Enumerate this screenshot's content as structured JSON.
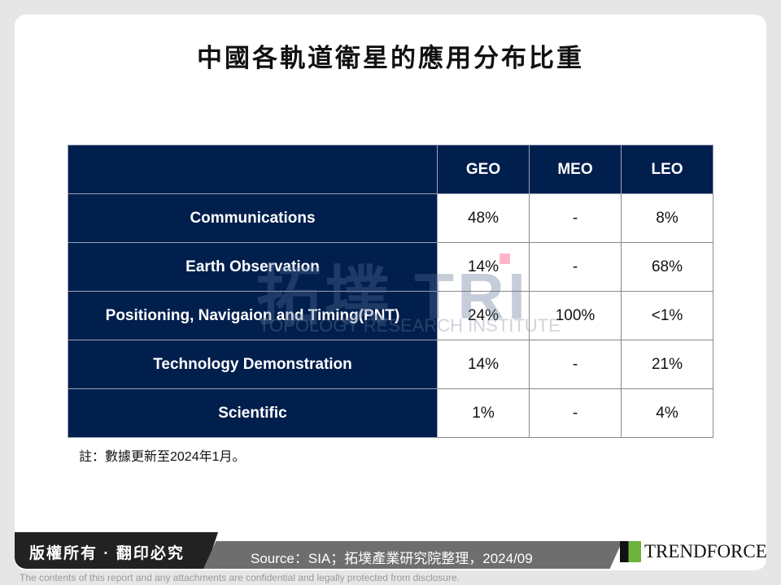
{
  "title": "中國各軌道衛星的應用分布比重",
  "table": {
    "headers": [
      "",
      "GEO",
      "MEO",
      "LEO"
    ],
    "rows": [
      {
        "label": "Communications",
        "values": [
          "48%",
          "-",
          "8%"
        ]
      },
      {
        "label": "Earth Observation",
        "values": [
          "14%",
          "-",
          "68%"
        ]
      },
      {
        "label": "Positioning, Navigaion and Timing(PNT)",
        "values": [
          "24%",
          "100%",
          "<1%"
        ]
      },
      {
        "label": "Technology Demonstration",
        "values": [
          "14%",
          "-",
          "21%"
        ]
      },
      {
        "label": "Scientific",
        "values": [
          "1%",
          "-",
          "4%"
        ]
      }
    ]
  },
  "note": "註：數據更新至2024年1月。",
  "watermark": {
    "main": "拓墣 TRI",
    "sub": "TOPOLOGY RESEARCH INSTITUTE"
  },
  "footer": {
    "copyright": "版權所有 · 翻印必究",
    "source": "Source：SIA；拓墣產業研究院整理，2024/09",
    "logo": "TRENDFORCE",
    "disclaimer": "The contents of this report and any attachments are confidential and legally protected from disclosure."
  },
  "colors": {
    "header_bg": "#001f4d",
    "logo_green": "#6cb33e"
  }
}
